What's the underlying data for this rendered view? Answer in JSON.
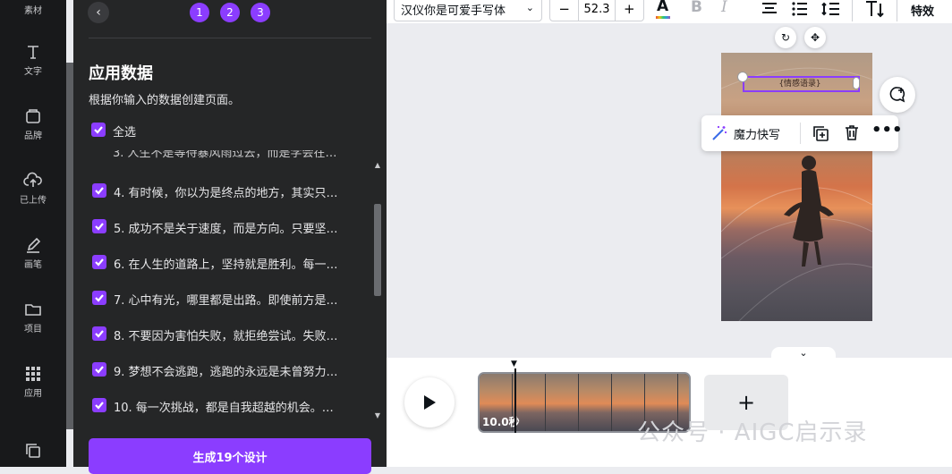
{
  "rail": {
    "items": [
      {
        "label": "素材"
      },
      {
        "label": "文字"
      },
      {
        "label": "品牌"
      },
      {
        "label": "已上传"
      },
      {
        "label": "画笔"
      },
      {
        "label": "项目"
      },
      {
        "label": "应用"
      }
    ]
  },
  "panel": {
    "steps": [
      "1",
      "2",
      "3"
    ],
    "title": "应用数据",
    "description": "根据你输入的数据创建页面。",
    "select_all": "全选",
    "rows": [
      "3. 人生不是等待暴风雨过去，而是学会在…",
      "4. 有时候，你以为是终点的地方，其实只…",
      "5. 成功不是关于速度，而是方向。只要坚…",
      "6. 在人生的道路上，坚持就是胜利。每一…",
      "7. 心中有光，哪里都是出路。即使前方是…",
      "8. 不要因为害怕失败，就拒绝尝试。失败…",
      "9. 梦想不会逃跑，逃跑的永远是未曾努力…",
      "10. 每一次挑战，都是自我超越的机会。…"
    ],
    "generate_button": "生成19个设计"
  },
  "toolbar": {
    "font_name": "汉仪你是可爱手写体",
    "font_size": "52.3",
    "minus": "−",
    "plus": "+",
    "effects": "特效"
  },
  "canvas": {
    "text_content": "{情感语录}",
    "magic_write": "魔力快写"
  },
  "timeline": {
    "duration": "10.0秒",
    "add_page": "+"
  },
  "watermark": "公众号 · AIGC启示录",
  "colors": {
    "accent": "#8b3dff",
    "rail_bg": "#18191b",
    "panel_bg": "#252627"
  }
}
